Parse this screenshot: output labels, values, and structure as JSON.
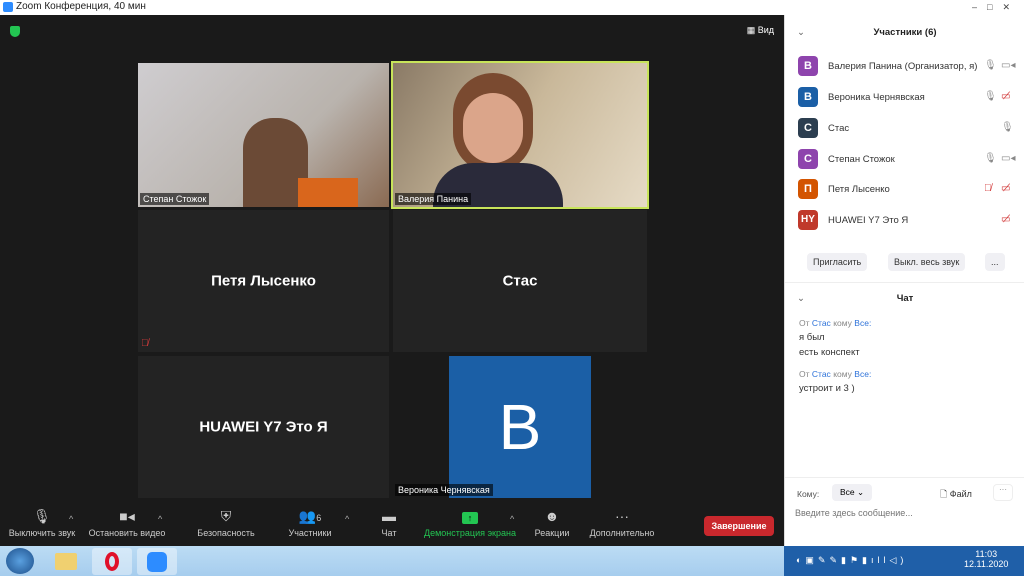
{
  "title": "Zoom Конференция, 40 мин",
  "view_label": "Вид",
  "tiles": [
    {
      "name": "Степан Стожок"
    },
    {
      "name": "Валерия Панина"
    },
    {
      "name": "Петя Лысенко"
    },
    {
      "name": "Стас"
    },
    {
      "name": "HUAWEI Y7 Это Я"
    },
    {
      "name": "Вероника Чернявская",
      "initial": "B"
    }
  ],
  "toolbar": {
    "mute": "Выключить звук",
    "video": "Остановить видео",
    "security": "Безопасность",
    "participants": "Участники",
    "participants_count": "6",
    "chat": "Чат",
    "share": "Демонстрация экрана",
    "reactions": "Реакции",
    "more": "Дополнительно",
    "end": "Завершение"
  },
  "participants_panel": {
    "title": "Участники (6)",
    "items": [
      {
        "initial": "В",
        "name": "Валерия Панина (Организатор, я)",
        "color": "#8e44ad"
      },
      {
        "initial": "В",
        "name": "Вероника Чернявская",
        "color": "#1b5fa6"
      },
      {
        "initial": "С",
        "name": "Стас",
        "color": "#2c3e50"
      },
      {
        "initial": "С",
        "name": "Степан Стожок",
        "color": "#8e44ad"
      },
      {
        "initial": "П",
        "name": "Петя Лысенко",
        "color": "#d35400"
      },
      {
        "initial": "HY",
        "name": "HUAWEI Y7 Это Я",
        "color": "#c0392b"
      }
    ],
    "invite": "Пригласить",
    "mute_all": "Выкл. весь звук",
    "more": "..."
  },
  "chat": {
    "title": "Чат",
    "messages": [
      {
        "from_prefix": "От",
        "from": "Стас",
        "to_prefix": "кому",
        "to": "Все:",
        "lines": [
          "я был",
          "есть конспект"
        ]
      },
      {
        "from_prefix": "От",
        "from": "Стас",
        "to_prefix": "кому",
        "to": "Все:",
        "lines": [
          "устроит и 3 )"
        ]
      }
    ],
    "to_label": "Кому:",
    "to_value": "Все",
    "file": "Файл",
    "more": "···",
    "placeholder": "Введите здесь сообщение..."
  },
  "clock": {
    "time": "11:03",
    "date": "12.11.2020"
  }
}
